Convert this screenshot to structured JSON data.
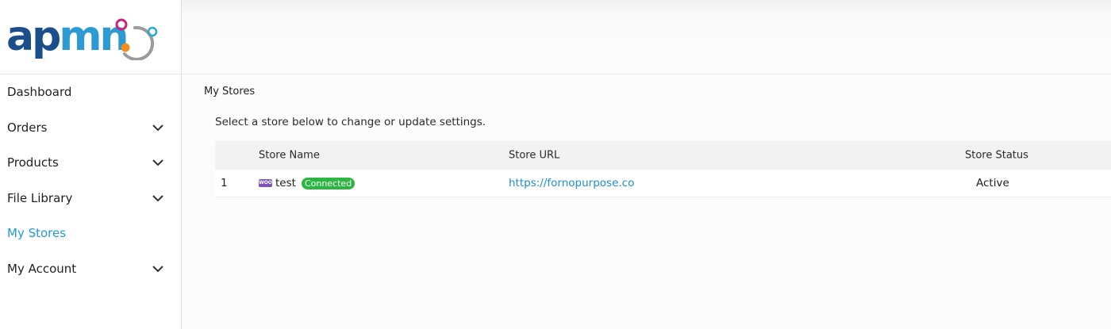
{
  "brand": {
    "logo_ap": "ap",
    "logo_mn": "mn",
    "colors": {
      "dark_blue": "#1b4f8c",
      "light_blue": "#2c9ad3",
      "magenta": "#c8237e",
      "orange": "#f28c1b",
      "gray": "#9b9b9b",
      "cyan": "#2aa7d6"
    }
  },
  "sidebar": {
    "items": [
      {
        "label": "Dashboard",
        "has_chevron": false,
        "active": false
      },
      {
        "label": "Orders",
        "has_chevron": true,
        "active": false
      },
      {
        "label": "Products",
        "has_chevron": true,
        "active": false
      },
      {
        "label": "File Library",
        "has_chevron": true,
        "active": false
      },
      {
        "label": "My Stores",
        "has_chevron": false,
        "active": true
      },
      {
        "label": "My Account",
        "has_chevron": true,
        "active": false
      }
    ],
    "chevron_icon": "chevron-down-icon",
    "active_color": "#1e9bd7"
  },
  "main": {
    "title": "My Stores",
    "hint": "Select a store below to change or update settings.",
    "table": {
      "headers": {
        "name": "Store Name",
        "url": "Store URL",
        "status": "Store Status"
      },
      "rows": [
        {
          "index": "1",
          "platform_icon": "woocommerce-icon",
          "platform_icon_text": "WOO",
          "name": "test",
          "badge": "Connected",
          "url": "https://fornopurpose.co",
          "status": "Active"
        }
      ]
    },
    "badge_color": "#2bb541",
    "link_color": "#1e8fd0"
  }
}
